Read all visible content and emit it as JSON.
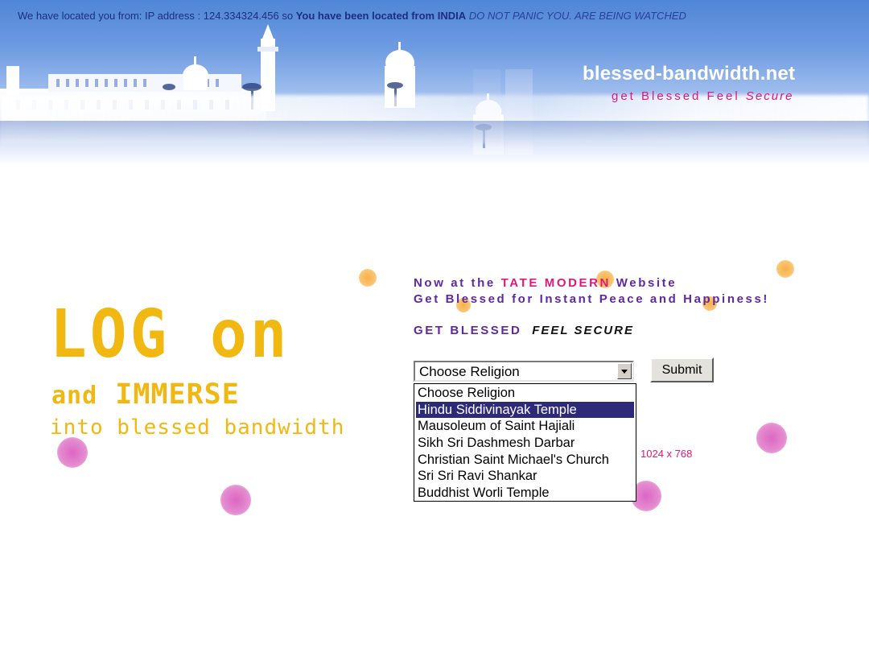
{
  "header": {
    "ticker_prefix": "We have located you from: IP address : 124.334324.456 so",
    "ticker_bold": "You have been located from INDIA",
    "ticker_warning": "DO NOT PANIC YOU. ARE BEING WATCHED",
    "brand": "blessed-bandwidth.net",
    "tagline_blessed": "get Blessed  Feel",
    "tagline_secure": "Secure"
  },
  "headline": {
    "line1": "LOG on",
    "line2_small": "and",
    "line2_big": "IMMERSE",
    "line3": "into blessed bandwidth"
  },
  "intro": {
    "line1_pre": "Now at the",
    "line1_highlight": "TATE MODERN",
    "line1_post": "Website",
    "line2": "Get Blessed for Instant Peace and Happiness!",
    "cta_left": "GET BLESSED",
    "cta_right": "FEEL SECURE"
  },
  "form": {
    "select_value": "Choose Religion",
    "submit_label": "Submit",
    "options": [
      "Choose Religion",
      "Hindu Siddivinayak Temple",
      "Mausoleum of Saint Hajiali",
      "Sikh Sri Dashmesh Darbar",
      "Christian Saint Michael's Church",
      "Sri Sri Ravi Shankar",
      "Buddhist Worli Temple"
    ],
    "highlighted_option": 1
  },
  "resolution_note": "1024 x 768",
  "colors": {
    "headline_yellow": "#f2b812",
    "purple_text": "#5e2a9e",
    "magenta_text": "#e0187a",
    "ticker_navy": "#1c2f7a",
    "selection_blue": "#2e2a7a"
  }
}
